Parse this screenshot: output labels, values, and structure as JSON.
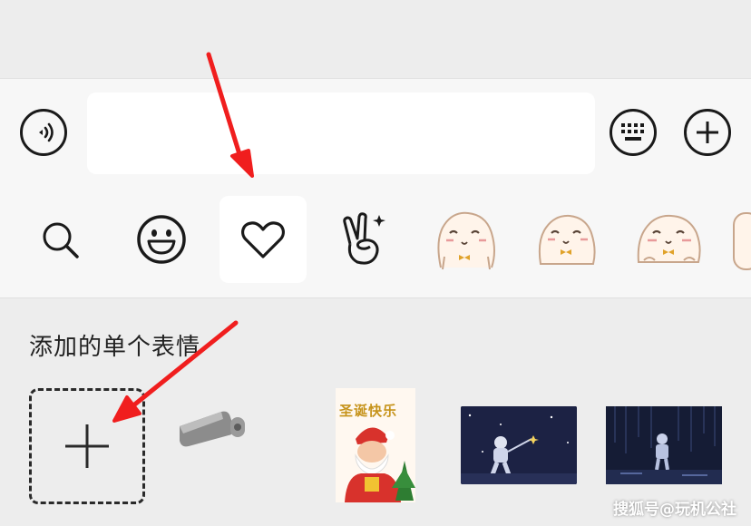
{
  "chat_input": {
    "value": "",
    "placeholder": ""
  },
  "buttons": {
    "voice_icon": "voice-icon",
    "keyboard_icon": "keyboard-icon",
    "plus_icon": "plus-icon"
  },
  "sticker_tabs": [
    {
      "icon": "search-icon"
    },
    {
      "icon": "smiley-icon"
    },
    {
      "icon": "heart-icon",
      "active": true
    },
    {
      "icon": "victory-hand-icon"
    },
    {
      "icon": "seal-sticker-icon"
    },
    {
      "icon": "seal-sticker-icon"
    },
    {
      "icon": "seal-sticker-icon"
    }
  ],
  "panel": {
    "section_title": "添加的单个表情",
    "add_tile_icon": "plus-icon",
    "stickers": [
      {
        "name": "camera-sticker"
      },
      {
        "name": "christmas-sticker",
        "text": "圣诞快乐"
      },
      {
        "name": "astronaut-sticker"
      },
      {
        "name": "starfield-sticker"
      }
    ]
  },
  "watermark": "搜狐号@玩机公社",
  "colors": {
    "arrow": "#f01e1e",
    "bar_bg": "#f7f7f7",
    "panel_bg": "#ededed"
  }
}
